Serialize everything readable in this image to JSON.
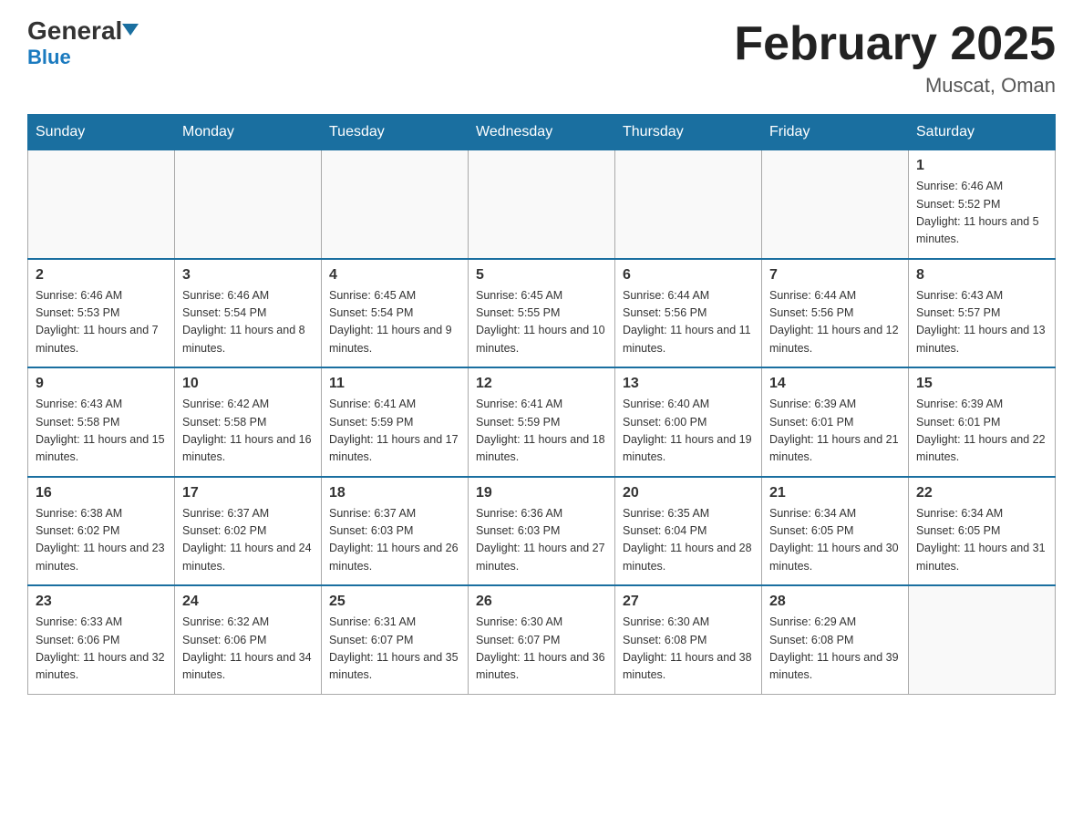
{
  "logo": {
    "general": "General",
    "arrow": "▼",
    "blue": "Blue"
  },
  "header": {
    "title": "February 2025",
    "location": "Muscat, Oman"
  },
  "weekdays": [
    "Sunday",
    "Monday",
    "Tuesday",
    "Wednesday",
    "Thursday",
    "Friday",
    "Saturday"
  ],
  "weeks": [
    [
      {
        "day": "",
        "info": ""
      },
      {
        "day": "",
        "info": ""
      },
      {
        "day": "",
        "info": ""
      },
      {
        "day": "",
        "info": ""
      },
      {
        "day": "",
        "info": ""
      },
      {
        "day": "",
        "info": ""
      },
      {
        "day": "1",
        "info": "Sunrise: 6:46 AM\nSunset: 5:52 PM\nDaylight: 11 hours and 5 minutes."
      }
    ],
    [
      {
        "day": "2",
        "info": "Sunrise: 6:46 AM\nSunset: 5:53 PM\nDaylight: 11 hours and 7 minutes."
      },
      {
        "day": "3",
        "info": "Sunrise: 6:46 AM\nSunset: 5:54 PM\nDaylight: 11 hours and 8 minutes."
      },
      {
        "day": "4",
        "info": "Sunrise: 6:45 AM\nSunset: 5:54 PM\nDaylight: 11 hours and 9 minutes."
      },
      {
        "day": "5",
        "info": "Sunrise: 6:45 AM\nSunset: 5:55 PM\nDaylight: 11 hours and 10 minutes."
      },
      {
        "day": "6",
        "info": "Sunrise: 6:44 AM\nSunset: 5:56 PM\nDaylight: 11 hours and 11 minutes."
      },
      {
        "day": "7",
        "info": "Sunrise: 6:44 AM\nSunset: 5:56 PM\nDaylight: 11 hours and 12 minutes."
      },
      {
        "day": "8",
        "info": "Sunrise: 6:43 AM\nSunset: 5:57 PM\nDaylight: 11 hours and 13 minutes."
      }
    ],
    [
      {
        "day": "9",
        "info": "Sunrise: 6:43 AM\nSunset: 5:58 PM\nDaylight: 11 hours and 15 minutes."
      },
      {
        "day": "10",
        "info": "Sunrise: 6:42 AM\nSunset: 5:58 PM\nDaylight: 11 hours and 16 minutes."
      },
      {
        "day": "11",
        "info": "Sunrise: 6:41 AM\nSunset: 5:59 PM\nDaylight: 11 hours and 17 minutes."
      },
      {
        "day": "12",
        "info": "Sunrise: 6:41 AM\nSunset: 5:59 PM\nDaylight: 11 hours and 18 minutes."
      },
      {
        "day": "13",
        "info": "Sunrise: 6:40 AM\nSunset: 6:00 PM\nDaylight: 11 hours and 19 minutes."
      },
      {
        "day": "14",
        "info": "Sunrise: 6:39 AM\nSunset: 6:01 PM\nDaylight: 11 hours and 21 minutes."
      },
      {
        "day": "15",
        "info": "Sunrise: 6:39 AM\nSunset: 6:01 PM\nDaylight: 11 hours and 22 minutes."
      }
    ],
    [
      {
        "day": "16",
        "info": "Sunrise: 6:38 AM\nSunset: 6:02 PM\nDaylight: 11 hours and 23 minutes."
      },
      {
        "day": "17",
        "info": "Sunrise: 6:37 AM\nSunset: 6:02 PM\nDaylight: 11 hours and 24 minutes."
      },
      {
        "day": "18",
        "info": "Sunrise: 6:37 AM\nSunset: 6:03 PM\nDaylight: 11 hours and 26 minutes."
      },
      {
        "day": "19",
        "info": "Sunrise: 6:36 AM\nSunset: 6:03 PM\nDaylight: 11 hours and 27 minutes."
      },
      {
        "day": "20",
        "info": "Sunrise: 6:35 AM\nSunset: 6:04 PM\nDaylight: 11 hours and 28 minutes."
      },
      {
        "day": "21",
        "info": "Sunrise: 6:34 AM\nSunset: 6:05 PM\nDaylight: 11 hours and 30 minutes."
      },
      {
        "day": "22",
        "info": "Sunrise: 6:34 AM\nSunset: 6:05 PM\nDaylight: 11 hours and 31 minutes."
      }
    ],
    [
      {
        "day": "23",
        "info": "Sunrise: 6:33 AM\nSunset: 6:06 PM\nDaylight: 11 hours and 32 minutes."
      },
      {
        "day": "24",
        "info": "Sunrise: 6:32 AM\nSunset: 6:06 PM\nDaylight: 11 hours and 34 minutes."
      },
      {
        "day": "25",
        "info": "Sunrise: 6:31 AM\nSunset: 6:07 PM\nDaylight: 11 hours and 35 minutes."
      },
      {
        "day": "26",
        "info": "Sunrise: 6:30 AM\nSunset: 6:07 PM\nDaylight: 11 hours and 36 minutes."
      },
      {
        "day": "27",
        "info": "Sunrise: 6:30 AM\nSunset: 6:08 PM\nDaylight: 11 hours and 38 minutes."
      },
      {
        "day": "28",
        "info": "Sunrise: 6:29 AM\nSunset: 6:08 PM\nDaylight: 11 hours and 39 minutes."
      },
      {
        "day": "",
        "info": ""
      }
    ]
  ]
}
